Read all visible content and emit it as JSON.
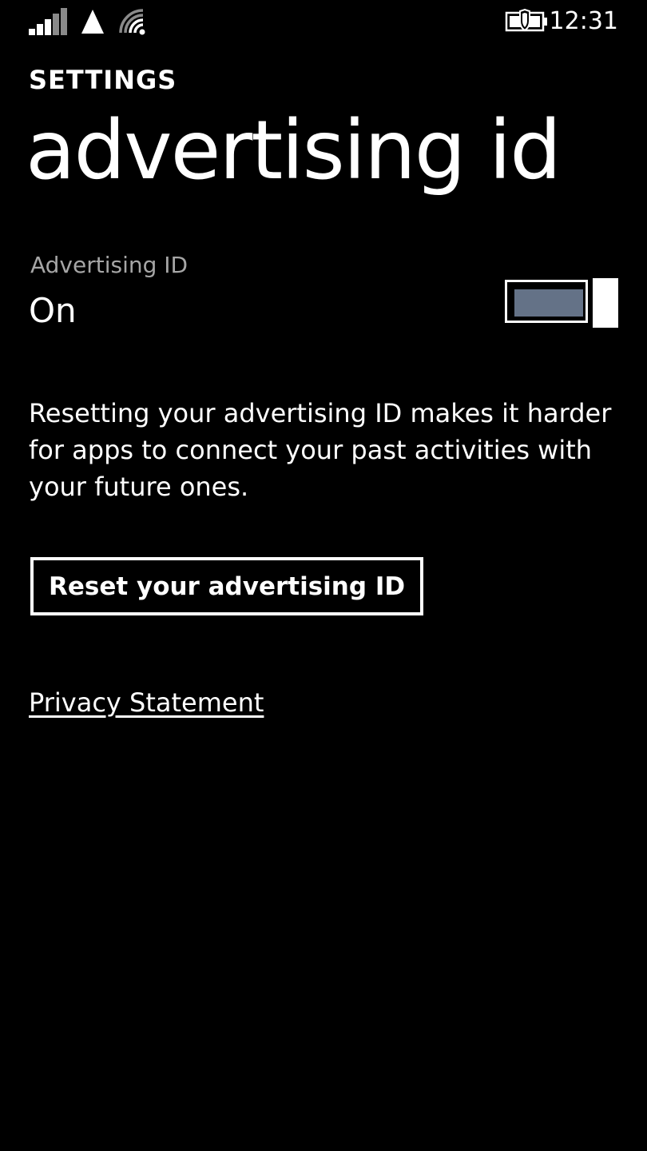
{
  "status_bar": {
    "time": "12:31",
    "icons": [
      "signal-strength-icon",
      "data-connection-icon",
      "wifi-icon",
      "battery-saver-icon"
    ]
  },
  "header": {
    "app_title": "SETTINGS",
    "page_title": "advertising id"
  },
  "advertising_setting": {
    "label": "Advertising ID",
    "value": "On",
    "toggle_on": true,
    "toggle_fill_color": "#647287"
  },
  "description": "Resetting your advertising ID makes it harder for apps to connect your past activities with your future ones.",
  "reset_button_label": "Reset your advertising ID",
  "privacy_link_label": "Privacy Statement",
  "colors": {
    "background": "#000000",
    "text": "#ffffff",
    "secondary_text": "#a6a6a6"
  }
}
